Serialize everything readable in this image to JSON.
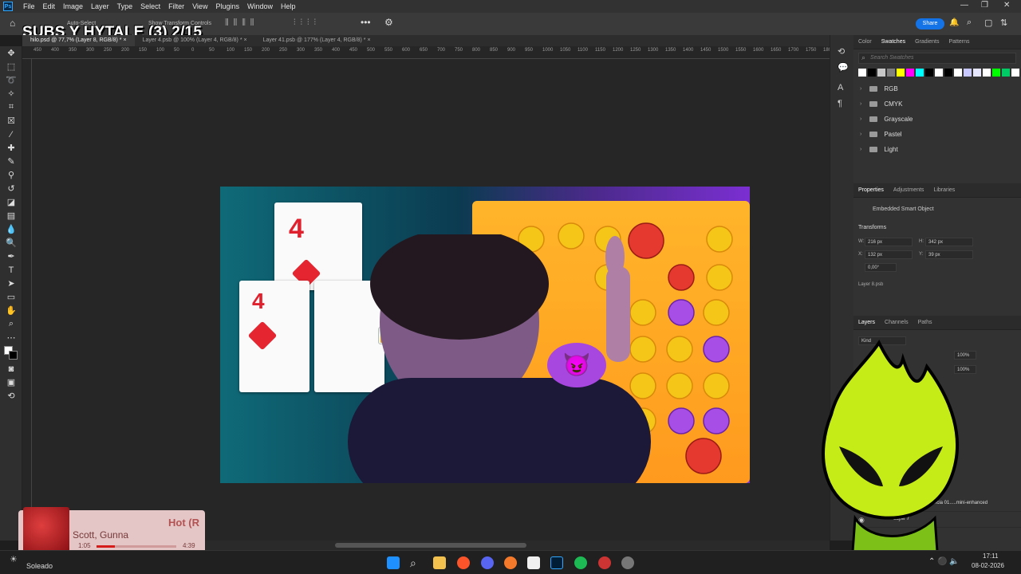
{
  "menubar": {
    "logo": "Ps",
    "items": [
      "File",
      "Edit",
      "Image",
      "Layer",
      "Type",
      "Select",
      "Filter",
      "View",
      "Plugins",
      "Window",
      "Help"
    ]
  },
  "optbar": {
    "auto_select": "Auto-Select",
    "show_transform": "Show Transform Controls",
    "share": "Share"
  },
  "overlay_title": "SUBS Y HYTALE (3) 2/15",
  "tabs": [
    {
      "label": "hilo.psd @ 77,7% (Layer 8, RGB/8) *",
      "active": true
    },
    {
      "label": "Layer 4.psb @ 100% (Layer 4, RGB/8) *",
      "active": false
    },
    {
      "label": "Layer 41.psb @ 177% (Layer 4, RGB/8) *",
      "active": false
    }
  ],
  "ruler_ticks": [
    "450",
    "400",
    "350",
    "300",
    "250",
    "200",
    "150",
    "100",
    "50",
    "0",
    "50",
    "100",
    "150",
    "200",
    "250",
    "300",
    "350",
    "400",
    "450",
    "500",
    "550",
    "600",
    "650",
    "700",
    "750",
    "800",
    "850",
    "900",
    "950",
    "1000",
    "1050",
    "1100",
    "1150",
    "1200",
    "1250",
    "1300",
    "1350",
    "1400",
    "1450",
    "1500",
    "1550",
    "1600",
    "1650",
    "1700",
    "1750",
    "1800"
  ],
  "artboard": {
    "card1_num": "4",
    "card2_num": "4"
  },
  "swatches_panel": {
    "tabs": [
      "Color",
      "Swatches",
      "Gradients",
      "Patterns"
    ],
    "active_tab": "Swatches",
    "search_placeholder": "Search Swatches",
    "colors": [
      "#ffffff",
      "#000000",
      "#c8c8c8",
      "#7f7f7f",
      "#ffff00",
      "#ff00ff",
      "#00ffff",
      "#000000",
      "#ffffff",
      "#000000",
      "#ffffff",
      "#c8c8ff",
      "#e6e6ff",
      "#ffffff",
      "#00ff00",
      "#00cc66",
      "#ffffff"
    ],
    "groups": [
      "RGB",
      "CMYK",
      "Grayscale",
      "Pastel",
      "Light"
    ]
  },
  "properties_panel": {
    "tabs": [
      "Properties",
      "Adjustments",
      "Libraries"
    ],
    "type": "Embedded Smart Object",
    "section": "Transforms",
    "w_label": "W:",
    "w_value": "216 px",
    "h_label": "H:",
    "h_value": "342 px",
    "x_label": "X:",
    "x_value": "132 px",
    "y_label": "Y:",
    "y_value": "39 px",
    "angle_value": "0,00°",
    "layer_name": "Layer 8.psb"
  },
  "layers_panel": {
    "tabs": [
      "Layers",
      "Channels",
      "Paths"
    ],
    "kind_label": "Kind",
    "opacity": "100%",
    "fill": "100%",
    "layer_a": "Secuencia 01.....mini-enhanced",
    "layer_b": "Layer 7"
  },
  "music": {
    "title": "Hot (R",
    "artist": "Scott, Gunna",
    "elapsed": "1:05",
    "duration": "4:39",
    "progress": 0.23
  },
  "taskbar": {
    "weather": "Soleado",
    "time": "17:11",
    "date": "08-02-2026"
  }
}
